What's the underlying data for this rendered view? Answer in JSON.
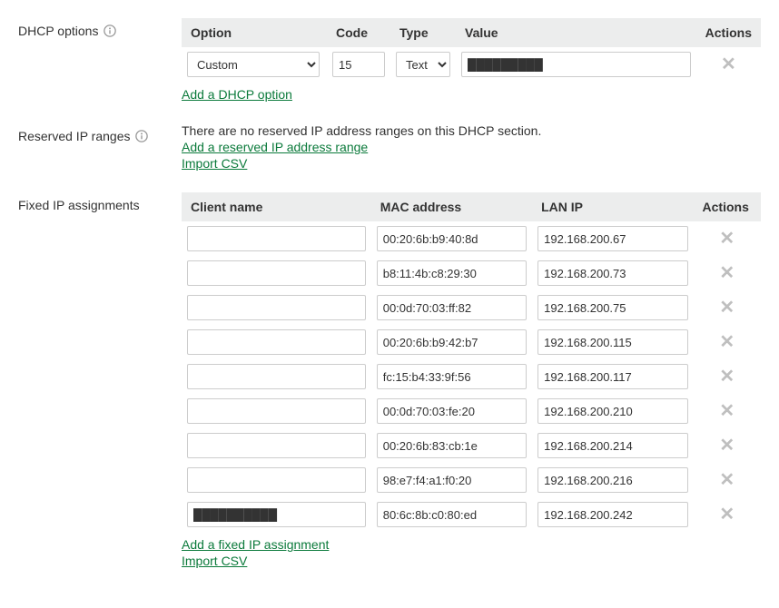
{
  "dhcp_options": {
    "label": "DHCP options",
    "headers": {
      "option": "Option",
      "code": "Code",
      "type": "Type",
      "value": "Value",
      "actions": "Actions"
    },
    "rows": [
      {
        "option": "Custom",
        "code": "15",
        "type": "Text",
        "value": "█████████"
      }
    ],
    "add_link": "Add a DHCP option"
  },
  "reserved_ip": {
    "label": "Reserved IP ranges",
    "empty_text": "There are no reserved IP address ranges on this DHCP section.",
    "add_link": "Add a reserved IP address range",
    "import_link": "Import CSV"
  },
  "fixed_ip": {
    "label": "Fixed IP assignments",
    "headers": {
      "client": "Client name",
      "mac": "MAC address",
      "lan": "LAN IP",
      "actions": "Actions"
    },
    "rows": [
      {
        "client": "",
        "mac": "00:20:6b:b9:40:8d",
        "lan": "192.168.200.67"
      },
      {
        "client": "",
        "mac": "b8:11:4b:c8:29:30",
        "lan": "192.168.200.73"
      },
      {
        "client": "",
        "mac": "00:0d:70:03:ff:82",
        "lan": "192.168.200.75"
      },
      {
        "client": "",
        "mac": "00:20:6b:b9:42:b7",
        "lan": "192.168.200.115"
      },
      {
        "client": "",
        "mac": "fc:15:b4:33:9f:56",
        "lan": "192.168.200.117"
      },
      {
        "client": "",
        "mac": "00:0d:70:03:fe:20",
        "lan": "192.168.200.210"
      },
      {
        "client": "",
        "mac": "00:20:6b:83:cb:1e",
        "lan": "192.168.200.214"
      },
      {
        "client": "",
        "mac": "98:e7:f4:a1:f0:20",
        "lan": "192.168.200.216"
      },
      {
        "client": "██████████",
        "redacted": true,
        "mac": "80:6c:8b:c0:80:ed",
        "lan": "192.168.200.242"
      }
    ],
    "add_link": "Add a fixed IP assignment",
    "import_link": "Import CSV"
  },
  "glyphs": {
    "delete_x": "✕"
  }
}
